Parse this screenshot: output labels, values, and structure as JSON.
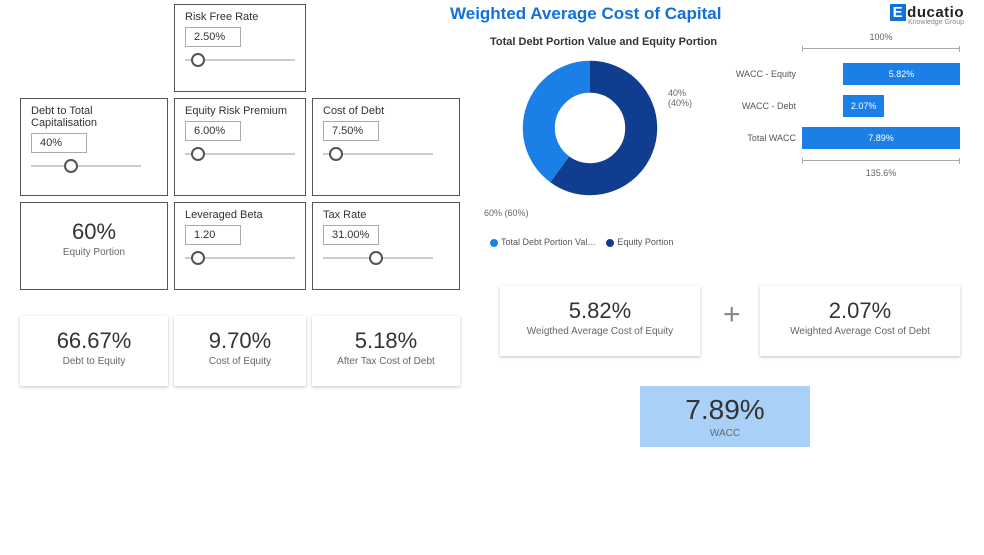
{
  "title": "Weighted Average Cost of Capital",
  "logo": {
    "text": "ducatio",
    "subtitle": "Knowledge Group"
  },
  "inputs": {
    "risk_free_rate": {
      "label": "Risk Free Rate",
      "value": "2.50%",
      "knob_pct": 5
    },
    "debt_to_cap": {
      "label": "Debt to Total Capitalisation",
      "value": "40%",
      "knob_pct": 30
    },
    "equity_risk_prem": {
      "label": "Equity Risk Premium",
      "value": "6.00%",
      "knob_pct": 5
    },
    "cost_of_debt": {
      "label": "Cost of Debt",
      "value": "7.50%",
      "knob_pct": 5
    },
    "leveraged_beta": {
      "label": "Leveraged Beta",
      "value": "1.20",
      "knob_pct": 5
    },
    "tax_rate": {
      "label": "Tax Rate",
      "value": "31.00%",
      "knob_pct": 42
    }
  },
  "outputs": {
    "equity_portion": {
      "value": "60%",
      "caption": "Equity Portion"
    },
    "debt_to_equity": {
      "value": "66.67%",
      "caption": "Debt to Equity"
    },
    "cost_of_equity": {
      "value": "9.70%",
      "caption": "Cost of Equity"
    },
    "after_tax_cod": {
      "value": "5.18%",
      "caption": "After Tax Cost of Debt"
    },
    "wacc_equity": {
      "value": "5.82%",
      "caption": "Weigthed Average Cost of Equity"
    },
    "wacc_debt": {
      "value": "2.07%",
      "caption": "Weighted Average Cost of Debt"
    },
    "wacc": {
      "value": "7.89%",
      "caption": "WACC"
    }
  },
  "donut": {
    "title": "Total Debt Portion Value and Equity Portion",
    "legend": [
      "Total Debt Portion Val…",
      "Equity Portion"
    ],
    "labels": {
      "debt": "40%\n(40%)",
      "equity": "60% (60%)"
    }
  },
  "bar_chart": {
    "top_scale": "100%",
    "bottom_scale": "135.6%",
    "rows": [
      {
        "label": "WACC - Equity",
        "value": "5.82%",
        "start_pct": 26,
        "width_pct": 74
      },
      {
        "label": "WACC - Debt",
        "value": "2.07%",
        "start_pct": 26,
        "width_pct": 26
      },
      {
        "label": "Total WACC",
        "value": "7.89%",
        "start_pct": 0,
        "width_pct": 100
      }
    ]
  },
  "chart_data": {
    "donut": {
      "type": "pie",
      "title": "Total Debt Portion Value and Equity Portion",
      "categories": [
        "Total Debt Portion Value",
        "Equity Portion"
      ],
      "values": [
        40,
        60
      ]
    },
    "bar": {
      "type": "bar",
      "orientation": "horizontal",
      "categories": [
        "WACC - Equity",
        "WACC - Debt",
        "Total WACC"
      ],
      "values": [
        5.82,
        2.07,
        7.89
      ],
      "unit": "%",
      "top_scale_label": "100%",
      "bottom_scale_label": "135.6%"
    }
  }
}
